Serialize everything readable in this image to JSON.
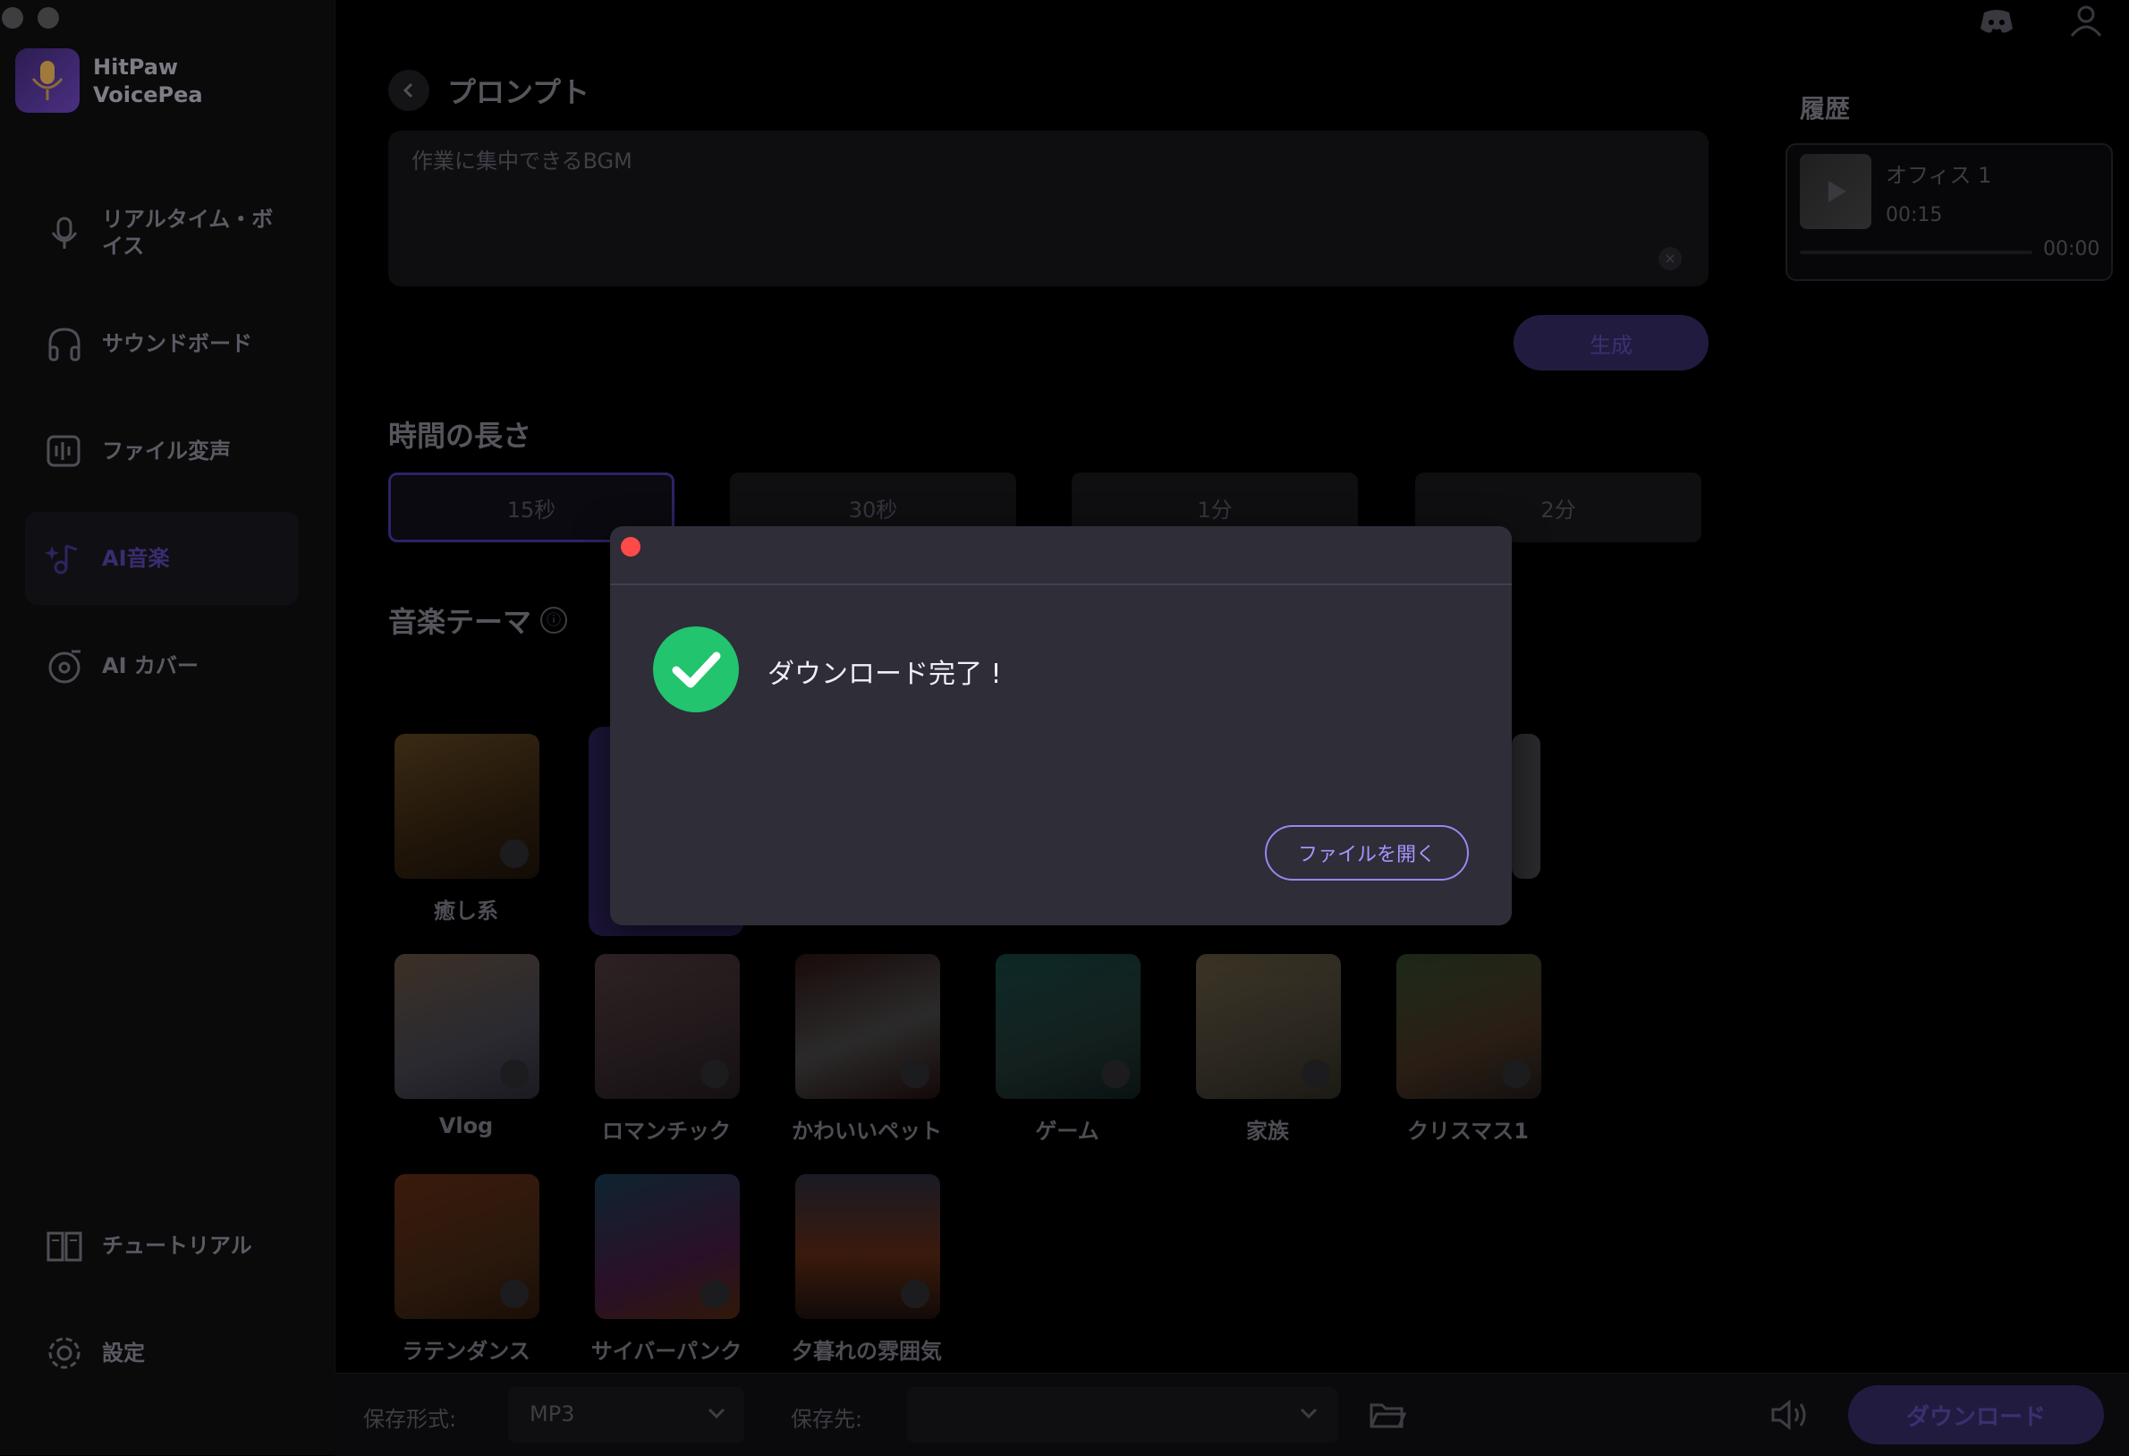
{
  "app": {
    "name_line1": "HitPaw",
    "name_line2": "VoicePea"
  },
  "sidebar": {
    "items": [
      {
        "label": "リアルタイム・ボイス",
        "icon": "microphone-icon"
      },
      {
        "label": "サウンドボード",
        "icon": "headphones-icon"
      },
      {
        "label": "ファイル変声",
        "icon": "waveform-file-icon"
      },
      {
        "label": "AI音楽",
        "icon": "ai-music-icon",
        "active": true
      },
      {
        "label": "AI カバー",
        "icon": "vinyl-icon"
      }
    ],
    "tutorial": "チュートリアル",
    "settings": "設定"
  },
  "prompt": {
    "title": "プロンプト",
    "text": "作業に集中できるBGM",
    "generate": "生成"
  },
  "duration": {
    "title": "時間の長さ",
    "options": [
      "15秒",
      "30秒",
      "1分",
      "2分"
    ],
    "selected": "15秒"
  },
  "themes": {
    "title": "音楽テーマ",
    "info_icon": "ⓘ",
    "items": [
      {
        "label": "癒し系"
      },
      {
        "label": "Vlog"
      },
      {
        "label": "ロマンチック"
      },
      {
        "label": "かわいいペット"
      },
      {
        "label": "ゲーム"
      },
      {
        "label": "家族"
      },
      {
        "label": "クリスマス1"
      },
      {
        "label": "ラテンダンス"
      },
      {
        "label": "サイバーパンク"
      },
      {
        "label": "夕暮れの雰囲気"
      }
    ]
  },
  "history": {
    "title": "履歴",
    "items": [
      {
        "name": "オフィス 1",
        "duration": "00:15",
        "position": "00:00"
      }
    ]
  },
  "bottom": {
    "format_label": "保存形式:",
    "format_value": "MP3",
    "dest_label": "保存先:",
    "download": "ダウンロード"
  },
  "dialog": {
    "message": "ダウンロード完了 !",
    "open_file": "ファイルを開く"
  }
}
